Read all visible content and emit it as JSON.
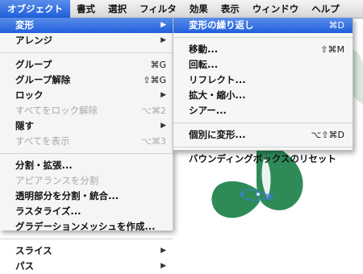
{
  "menubar": {
    "items": [
      "オブジェクト",
      "書式",
      "選択",
      "フィルタ",
      "効果",
      "表示",
      "ウィンドウ",
      "ヘルプ"
    ]
  },
  "main_menu": {
    "items": [
      {
        "label": "変形",
        "shortcut": "",
        "submenu": true
      },
      {
        "label": "アレンジ",
        "shortcut": "",
        "submenu": true
      },
      {
        "label": "グループ",
        "shortcut": "⌘G"
      },
      {
        "label": "グループ解除",
        "shortcut": "⇧⌘G"
      },
      {
        "label": "ロック",
        "shortcut": "",
        "submenu": true
      },
      {
        "label": "すべてをロック解除",
        "shortcut": "⌥⌘2"
      },
      {
        "label": "隠す",
        "shortcut": "",
        "submenu": true
      },
      {
        "label": "すべてを表示",
        "shortcut": "⌥⌘3"
      },
      {
        "label": "分割・拡張...",
        "shortcut": ""
      },
      {
        "label": "アピアランスを分割",
        "shortcut": ""
      },
      {
        "label": "透明部分を分割・統合...",
        "shortcut": ""
      },
      {
        "label": "ラスタライズ...",
        "shortcut": ""
      },
      {
        "label": "グラデーションメッシュを作成...",
        "shortcut": ""
      },
      {
        "label": "スライス",
        "shortcut": "",
        "submenu": true
      },
      {
        "label": "パス",
        "shortcut": "",
        "submenu": true
      }
    ]
  },
  "sub_menu": {
    "items": [
      {
        "label": "変形の繰り返し",
        "shortcut": "⌘D"
      },
      {
        "label": "移動...",
        "shortcut": "⇧⌘M"
      },
      {
        "label": "回転...",
        "shortcut": ""
      },
      {
        "label": "リフレクト...",
        "shortcut": ""
      },
      {
        "label": "拡大・縮小...",
        "shortcut": ""
      },
      {
        "label": "シアー...",
        "shortcut": ""
      },
      {
        "label": "個別に変形...",
        "shortcut": "⌥⇧⌘D"
      },
      {
        "label": "バウンディングボックスのリセット",
        "shortcut": ""
      }
    ]
  },
  "colors": {
    "accent": "#2a6ae0",
    "leaf_green": "#2e8b57",
    "selection_blue": "#3b7ddd"
  }
}
